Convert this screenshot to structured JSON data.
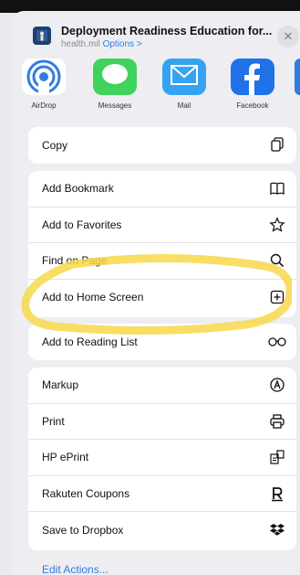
{
  "header": {
    "title": "Deployment Readiness Education for...",
    "domain": "health.mil",
    "options_label": "Options >",
    "close_label": "✕"
  },
  "apps": [
    {
      "label": "AirDrop",
      "icon": "airdrop-icon"
    },
    {
      "label": "Messages",
      "icon": "messages-icon"
    },
    {
      "label": "Mail",
      "icon": "mail-icon"
    },
    {
      "label": "Facebook",
      "icon": "facebook-icon"
    }
  ],
  "actions": {
    "copy": "Copy",
    "add_bookmark": "Add Bookmark",
    "add_favorites": "Add to Favorites",
    "find_on_page": "Find on Page",
    "add_home_screen": "Add to Home Screen",
    "add_reading_list": "Add to Reading List",
    "markup": "Markup",
    "print": "Print",
    "hp_eprint": "HP ePrint",
    "rakuten": "Rakuten Coupons",
    "dropbox": "Save to Dropbox"
  },
  "edit_actions": "Edit Actions...",
  "colors": {
    "accent": "#2f7de1",
    "highlight": "#f7d84a",
    "messages_green": "#3fd35b",
    "mail_blue": "#36a3f2",
    "facebook_blue": "#1f72e8"
  }
}
